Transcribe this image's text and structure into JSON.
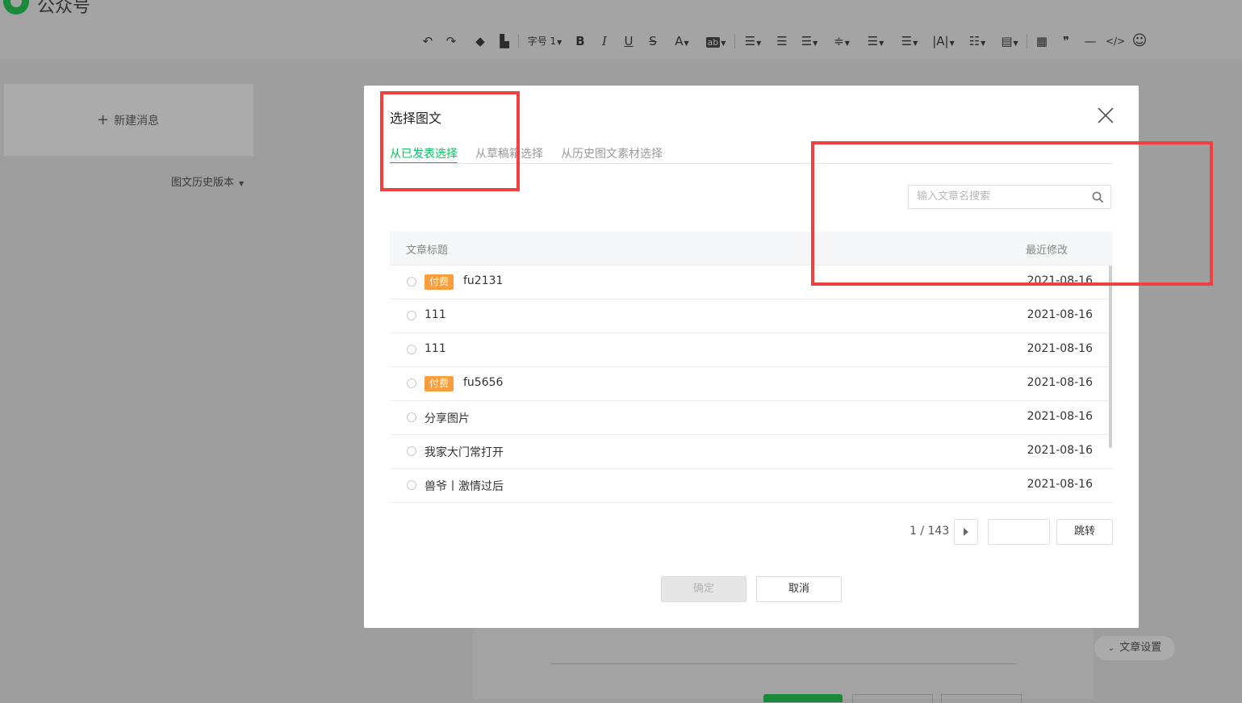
{
  "app": {
    "logo_text": "公众号"
  },
  "toolbar": {
    "font_size_label": "字号 1",
    "bold": "B",
    "italic": "I",
    "underline": "U",
    "strike": "S",
    "font_color": "A",
    "bg_color": "ab",
    "quote": "❞",
    "code": "</>"
  },
  "sidebar": {
    "new_message": "新建消息",
    "history_versions": "图文历史版本"
  },
  "editor": {
    "article_settings": "文章设置"
  },
  "dialog": {
    "title": "选择图文",
    "tabs": [
      {
        "label": "从已发表选择",
        "active": true
      },
      {
        "label": "从草稿箱选择",
        "active": false
      },
      {
        "label": "从历史图文素材选择",
        "active": false
      }
    ],
    "search": {
      "placeholder": "输入文章名搜索",
      "value": ""
    },
    "table": {
      "columns": [
        "文章标题",
        "最近修改"
      ],
      "rows": [
        {
          "badge": "付费",
          "title": "fu2131",
          "date": "2021-08-16"
        },
        {
          "badge": "",
          "title": "111",
          "date": "2021-08-16"
        },
        {
          "badge": "",
          "title": "111",
          "date": "2021-08-16"
        },
        {
          "badge": "付费",
          "title": "fu5656",
          "date": "2021-08-16"
        },
        {
          "badge": "",
          "title": "分享图片",
          "date": "2021-08-16"
        },
        {
          "badge": "",
          "title": "我家大门常打开",
          "date": "2021-08-16"
        },
        {
          "badge": "",
          "title": "兽爷丨激情过后",
          "date": "2021-08-16"
        }
      ]
    },
    "pagination": {
      "current": 1,
      "total": 143,
      "text": "1 / 143",
      "jump_label": "跳转"
    },
    "buttons": {
      "confirm": "确定",
      "cancel": "取消"
    }
  },
  "colors": {
    "accent_green": "#07c160",
    "badge_orange": "#fa9d3b",
    "highlight_red": "#f24040",
    "overlay_gray": "#9e9e9e"
  }
}
